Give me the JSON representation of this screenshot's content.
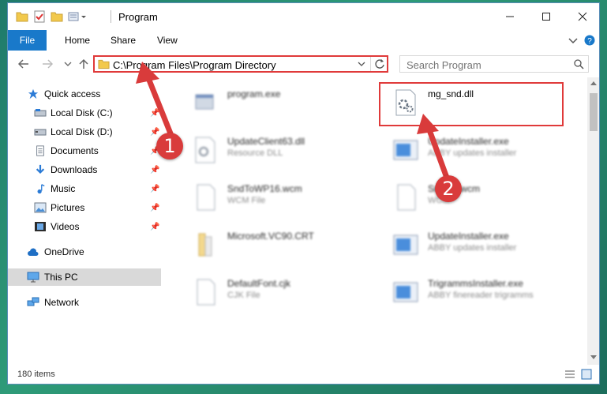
{
  "window": {
    "title": "Program"
  },
  "ribbon": {
    "tabs": [
      "File",
      "Home",
      "Share",
      "View"
    ]
  },
  "address": {
    "path": "C:\\Program Files\\Program Directory"
  },
  "search": {
    "placeholder": "Search Program"
  },
  "sidebar": {
    "items": [
      {
        "label": "Quick access",
        "icon": "star-icon",
        "pinned": false
      },
      {
        "label": "Local Disk (C:)",
        "icon": "drive-icon",
        "pinned": true
      },
      {
        "label": "Local Disk (D:)",
        "icon": "drive-icon",
        "pinned": true
      },
      {
        "label": "Documents",
        "icon": "documents-icon",
        "pinned": true
      },
      {
        "label": "Downloads",
        "icon": "download-icon",
        "pinned": true
      },
      {
        "label": "Music",
        "icon": "music-icon",
        "pinned": true
      },
      {
        "label": "Pictures",
        "icon": "pictures-icon",
        "pinned": true
      },
      {
        "label": "Videos",
        "icon": "videos-icon",
        "pinned": true
      },
      {
        "label": "OneDrive",
        "icon": "cloud-icon",
        "pinned": false
      },
      {
        "label": "This PC",
        "icon": "monitor-icon",
        "pinned": false,
        "selected": true
      },
      {
        "label": "Network",
        "icon": "network-icon",
        "pinned": false
      }
    ]
  },
  "files": [
    {
      "name": "program.exe",
      "type": ""
    },
    {
      "name": "mg_snd.dll",
      "type": ""
    },
    {
      "name": "UpdateClient63.dll",
      "type": "Resource DLL"
    },
    {
      "name": "UpdateInstaller.exe",
      "type": "ABBY updates installer"
    },
    {
      "name": "SndToWP16.wcm",
      "type": "WCM File"
    },
    {
      "name": "Snd...3.wcm",
      "type": "WC..."
    },
    {
      "name": "Microsoft.VC90.CRT",
      "type": ""
    },
    {
      "name": "UpdateInstaller.exe",
      "type": "ABBY updates installer"
    },
    {
      "name": "DefaultFont.cjk",
      "type": "CJK File"
    },
    {
      "name": "TrigrammsInstaller.exe",
      "type": "ABBY finereader trigramms"
    }
  ],
  "status": {
    "count": "180 items"
  },
  "annotations": {
    "marker1": "1",
    "marker2": "2"
  },
  "colors": {
    "accent": "#1979ca",
    "highlight": "#e03a3a"
  }
}
